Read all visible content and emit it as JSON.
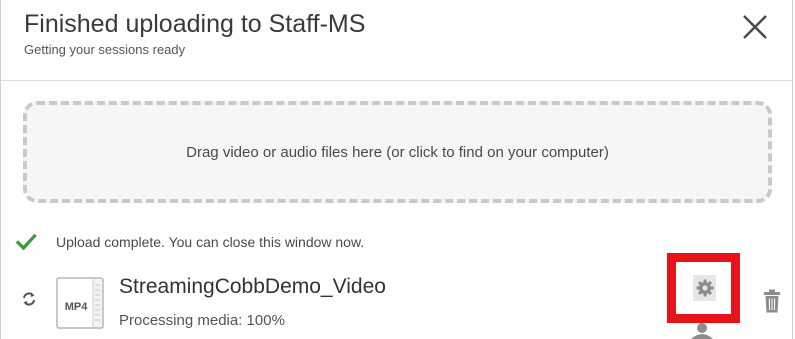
{
  "dialog": {
    "title": "Finished uploading to Staff-MS",
    "subtitle": "Getting your sessions ready",
    "close_icon": "close-icon"
  },
  "dropzone": {
    "text": "Drag video or audio files here (or click to find on your computer)"
  },
  "status": {
    "icon": "check-icon",
    "text": "Upload complete. You can close this window now."
  },
  "file": {
    "extension": "MP4",
    "name": "StreamingCobbDemo_Video",
    "progress_text": "Processing media: 100%",
    "progress_value": 100,
    "icons": [
      "refresh-icon",
      "file-icon",
      "gear-icon",
      "user-icon",
      "trash-icon"
    ]
  },
  "colors": {
    "success": "#3a9a3a",
    "highlight": "#e8121a",
    "icon_gray": "#8c8c8c"
  }
}
